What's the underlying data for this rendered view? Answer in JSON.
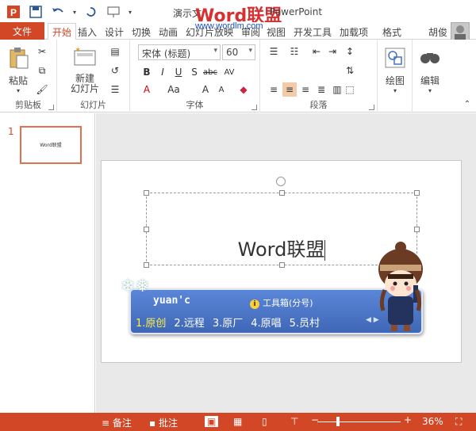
{
  "window": {
    "title_prefix": "演示文",
    "watermark_word": "Word",
    "watermark_cn": "联盟",
    "watermark_url": "www.wordlm.com",
    "title_suffix": "PowerPoint"
  },
  "tabs": {
    "file": "文件",
    "items": [
      "开始",
      "插入",
      "设计",
      "切换",
      "动画",
      "幻灯片放映",
      "审阅",
      "视图",
      "开发工具",
      "加载项",
      "格式"
    ],
    "user": "胡俊"
  },
  "ribbon": {
    "clipboard": {
      "paste": "粘贴",
      "label": "剪贴板"
    },
    "slides": {
      "new_slide": "新建\n幻灯片",
      "label": "幻灯片"
    },
    "font": {
      "font_name": "宋体 (标题)",
      "font_size": "60",
      "label": "字体"
    },
    "paragraph": {
      "label": "段落"
    },
    "drawing": {
      "label": "绘图"
    },
    "editing": {
      "label": "编辑"
    }
  },
  "slides_pane": {
    "slide_number": "1",
    "thumb_text": "Word联盟"
  },
  "slide": {
    "text": "Word联盟"
  },
  "ime": {
    "input": "yuan'c",
    "toolbox": "工具箱(分号)",
    "candidates": [
      "1.原创",
      "2.远程",
      "3.原厂",
      "4.原唱",
      "5.员村"
    ],
    "selected_index": 0
  },
  "statusbar": {
    "notes": "备注",
    "comments": "批注",
    "zoom": "36%",
    "zoom_value": 36
  },
  "colors": {
    "accent": "#d24726",
    "ime_bg": "#4b73c4"
  }
}
